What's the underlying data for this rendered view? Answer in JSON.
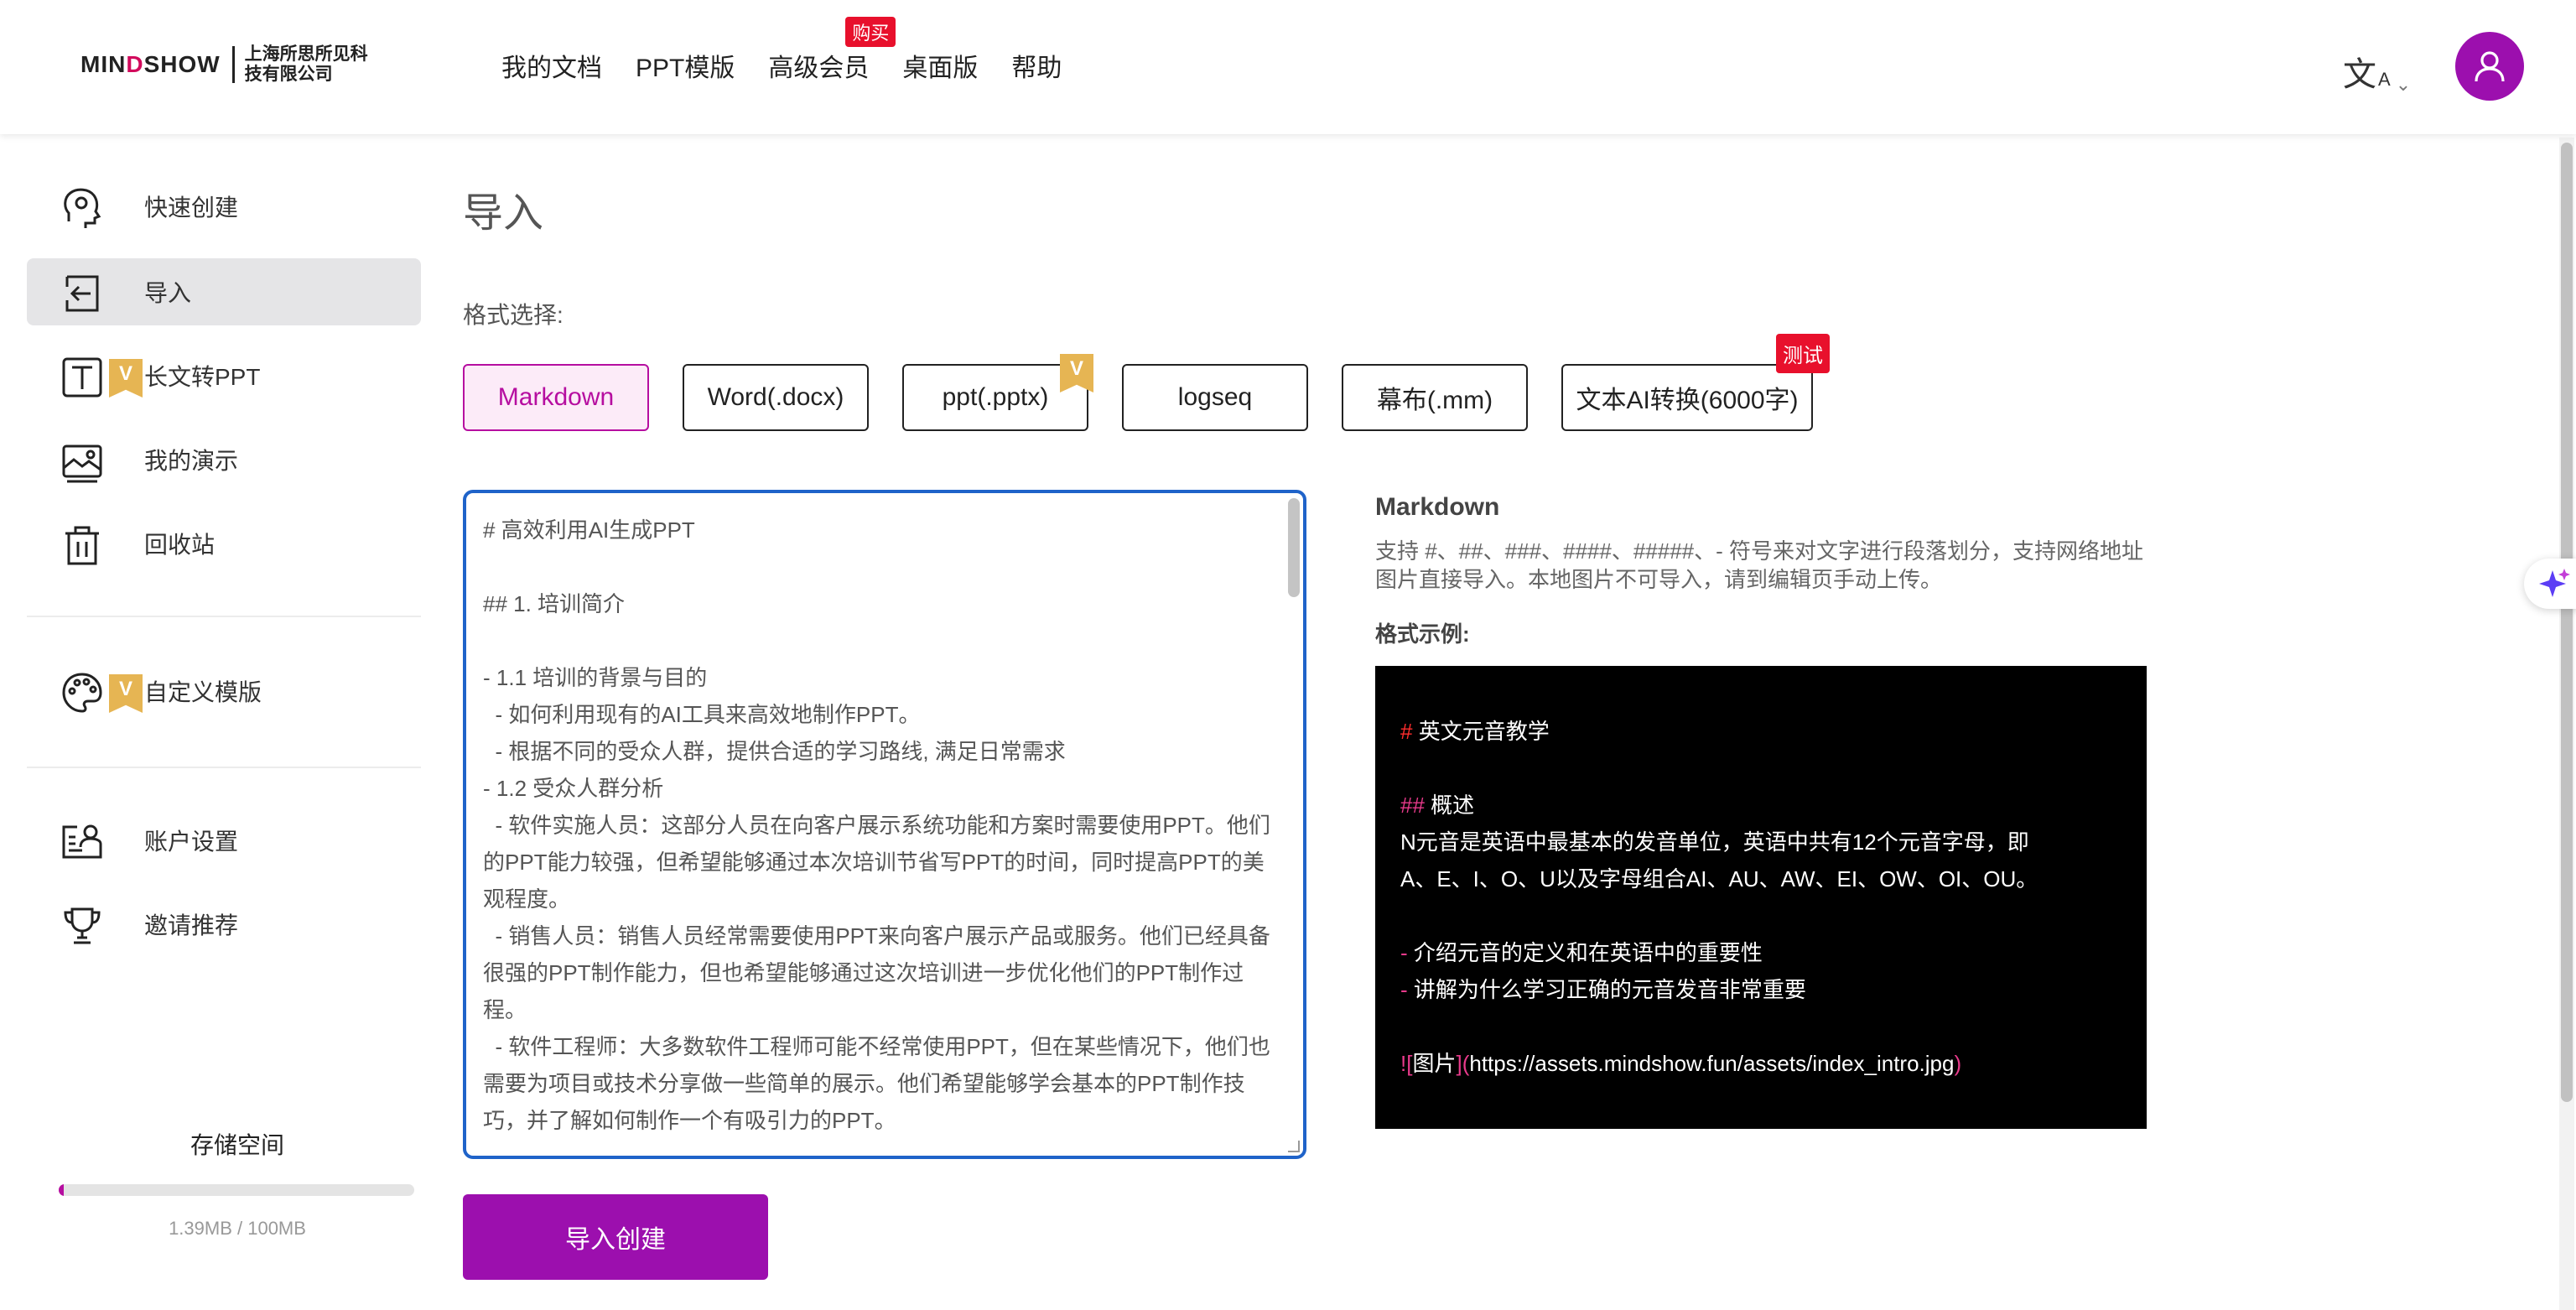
{
  "header": {
    "logo_en_prefix": "MIN",
    "logo_en_accent": "D",
    "logo_en_suffix": "SHOW",
    "logo_cn": "上海所思所见科技有限公司",
    "nav": [
      {
        "label": "我的文档"
      },
      {
        "label": "PPT模版"
      },
      {
        "label": "高级会员",
        "badge": "购买"
      },
      {
        "label": "桌面版"
      },
      {
        "label": "帮助"
      }
    ],
    "lang_icon_main": "文",
    "lang_icon_sub": "A",
    "avatar_icon": "user-icon"
  },
  "sidebar": {
    "items": [
      {
        "label": "快速创建",
        "icon": "brain-head-icon"
      },
      {
        "label": "导入",
        "icon": "import-icon",
        "active": true
      },
      {
        "label": "长文转PPT",
        "icon": "text-t-icon",
        "vip": "V"
      },
      {
        "label": "我的演示",
        "icon": "gallery-icon"
      },
      {
        "label": "回收站",
        "icon": "trash-icon"
      },
      {
        "label": "自定义模版",
        "icon": "palette-icon",
        "vip": "V"
      },
      {
        "label": "账户设置",
        "icon": "account-card-icon"
      },
      {
        "label": "邀请推荐",
        "icon": "trophy-icon"
      }
    ],
    "storage": {
      "title": "存储空间",
      "usage_text": "1.39MB / 100MB",
      "used_fraction": 0.0139
    }
  },
  "main": {
    "title": "导入",
    "format_label": "格式选择:",
    "formats": [
      {
        "label": "Markdown",
        "active": true
      },
      {
        "label": "Word(.docx)"
      },
      {
        "label": "ppt(.pptx)",
        "vip": "V"
      },
      {
        "label": "logseq"
      },
      {
        "label": "幕布(.mm)"
      },
      {
        "label": "文本AI转换(6000字)",
        "badge": "测试"
      }
    ],
    "editor_text": "# 高效利用AI生成PPT\n\n## 1. 培训简介\n\n- 1.1 培训的背景与目的\n  - 如何利用现有的AI工具来高效地制作PPT。\n  - 根据不同的受众人群，提供合适的学习路线, 满足日常需求\n- 1.2 受众人群分析\n  - 软件实施人员：这部分人员在向客户展示系统功能和方案时需要使用PPT。他们的PPT能力较强，但希望能够通过本次培训节省写PPT的时间，同时提高PPT的美观程度。\n  - 销售人员：销售人员经常需要使用PPT来向客户展示产品或服务。他们已经具备很强的PPT制作能力，但也希望能够通过这次培训进一步优化他们的PPT制作过程。\n  - 软件工程师：大多数软件工程师可能不经常使用PPT，但在某些情况下，他们也需要为项目或技术分享做一些简单的展示。他们希望能够学会基本的PPT制作技巧，并了解如何制作一个有吸引力的PPT。",
    "submit_label": "导入创建",
    "info": {
      "title": "Markdown",
      "desc": "支持 #、##、###、####、#####、- 符号来对文字进行段落划分，支持网络地址图片直接导入。本地图片不可导入，请到编辑页手动上传。",
      "example_label": "格式示例:",
      "example": {
        "h1_mark": "#",
        "h1_text": " 英文元音教学",
        "h2_mark": "##",
        "h2_text": " 概述",
        "para_line1": " N元音是英语中最基本的发音单位，英语中共有12个元音字母，即",
        "para_line2": "A、E、I、O、U以及字母组合AI、AU、AW、EI、OW、OI、OU。",
        "bullet1_mark": "-",
        "bullet1_text": " 介绍元音的定义和在英语中的重要性",
        "bullet2_mark": "-",
        "bullet2_text": " 讲解为什么学习正确的元音发音非常重要",
        "img_open": "![",
        "img_alt": "图片",
        "img_mid": "](",
        "img_url": "https://assets.mindshow.fun/assets/index_intro.jpg",
        "img_close": ")"
      }
    }
  },
  "colors": {
    "accent": "#9c0fae",
    "focus_border": "#1f63c9",
    "badge_red": "#e8102c",
    "vip_gold": "#e6b553",
    "active_format_bg": "#fcebf8"
  }
}
